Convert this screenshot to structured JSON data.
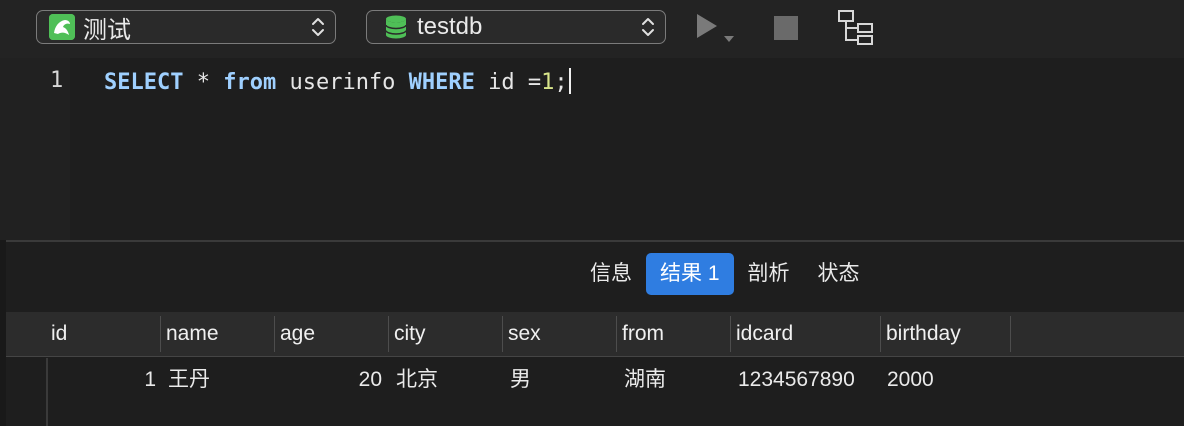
{
  "toolbar": {
    "connection": {
      "label": "测试",
      "icon": "dolphin-icon",
      "color": "#4fbf57"
    },
    "database": {
      "label": "testdb",
      "icon": "database-icon",
      "color": "#4fbf57"
    },
    "run_icon": "play-icon",
    "stop_icon": "stop-icon",
    "explain_icon": "tree-icon"
  },
  "editor": {
    "line_number": "1",
    "tokens": {
      "select": "SELECT",
      "star": " * ",
      "from": "from",
      "table": " userinfo ",
      "where": "WHERE",
      "cond": " id =",
      "value": "1",
      "end": ";"
    }
  },
  "result_tabs": [
    {
      "label": "信息",
      "active": false
    },
    {
      "label": "结果 1",
      "active": true
    },
    {
      "label": "剖析",
      "active": false
    },
    {
      "label": "状态",
      "active": false
    }
  ],
  "grid": {
    "columns": [
      "id",
      "name",
      "age",
      "city",
      "sex",
      "from",
      "idcard",
      "birthday"
    ],
    "rows": [
      [
        "1",
        "王丹",
        "20",
        "北京",
        "男",
        "湖南",
        "1234567890",
        "2000"
      ]
    ]
  },
  "colors": {
    "accent": "#2f7de1",
    "keyword": "#9fd0ff",
    "number": "#d8e58a"
  }
}
